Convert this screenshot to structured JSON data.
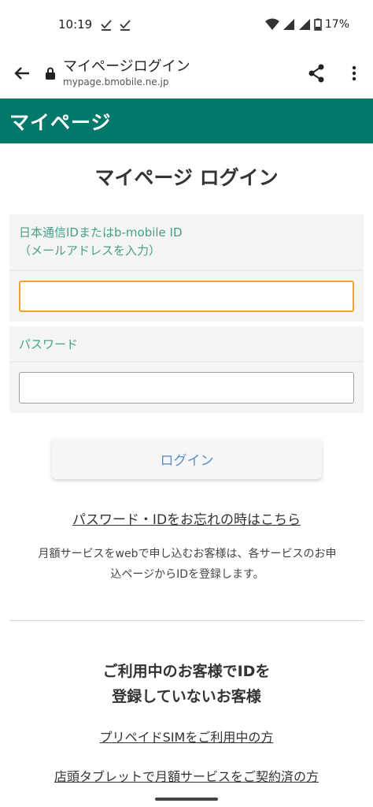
{
  "status_bar": {
    "time": "10:19",
    "battery": "17%"
  },
  "browser": {
    "page_title": "マイページログイン",
    "host": "mypage.bmobile.ne.jp"
  },
  "site": {
    "header_title": "マイページ",
    "accent_color": "#00796b"
  },
  "main": {
    "title": "マイページ ログイン",
    "id_field": {
      "label_line1": "日本通信IDまたはb-mobile ID",
      "label_line2": "（メールアドレスを入力）",
      "value": ""
    },
    "password_field": {
      "label": "パスワード",
      "value": ""
    },
    "login_button": "ログイン",
    "forgot_link": "パスワード・IDをお忘れの時はこちら",
    "notice_line1": "月額サービスをwebで申し込むお客様は、各サービスのお申",
    "notice_line2": "込ページからIDを登録します。"
  },
  "unregistered": {
    "heading_line1": "ご利用中のお客様でIDを",
    "heading_line2": "登録していないお客様",
    "links": [
      "プリペイドSIMをご利用中の方",
      "店頭タブレットで月額サービスをご契約済の方"
    ]
  }
}
